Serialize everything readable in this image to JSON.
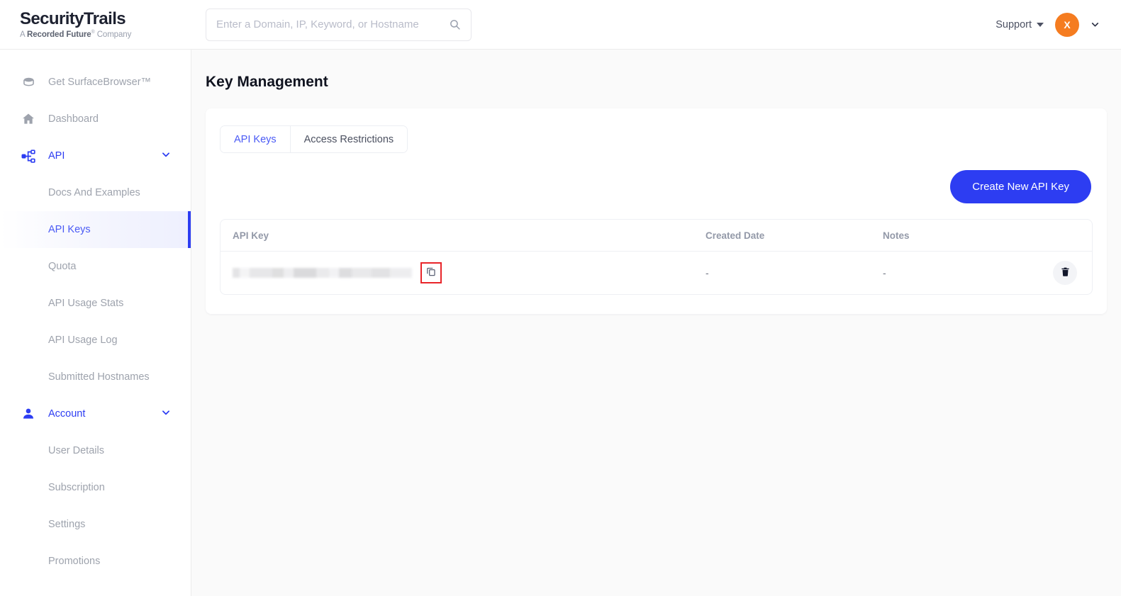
{
  "header": {
    "brand_main": "SecurityTrails",
    "brand_sub_pre": "A ",
    "brand_sub_bold": "Recorded Future",
    "brand_sub_post": " Company",
    "brand_sub_mark": "®",
    "search_placeholder": "Enter a Domain, IP, Keyword, or Hostname",
    "search_value": "",
    "search_icon": "search-icon",
    "support_label": "Support",
    "avatar_initial": "X",
    "avatar_color": "#f57c20",
    "user_chevron_icon": "chevron-down-icon"
  },
  "sidebar": {
    "items": [
      {
        "label": "Get SurfaceBrowser™",
        "icon": "database-icon",
        "type": "top",
        "state": "default"
      },
      {
        "label": "Dashboard",
        "icon": "home-icon",
        "type": "top",
        "state": "default"
      },
      {
        "label": "API",
        "icon": "sitemap-icon",
        "type": "top",
        "state": "expanded",
        "chevron": "chevron-down-icon"
      },
      {
        "label": "Docs And Examples",
        "type": "sub",
        "state": "default"
      },
      {
        "label": "API Keys",
        "type": "sub",
        "state": "active"
      },
      {
        "label": "Quota",
        "type": "sub",
        "state": "default"
      },
      {
        "label": "API Usage Stats",
        "type": "sub",
        "state": "default"
      },
      {
        "label": "API Usage Log",
        "type": "sub",
        "state": "default"
      },
      {
        "label": "Submitted Hostnames",
        "type": "sub",
        "state": "default"
      },
      {
        "label": "Account",
        "icon": "person-icon",
        "type": "top",
        "state": "expanded",
        "chevron": "chevron-down-icon"
      },
      {
        "label": "User Details",
        "type": "sub",
        "state": "default"
      },
      {
        "label": "Subscription",
        "type": "sub",
        "state": "default"
      },
      {
        "label": "Settings",
        "type": "sub",
        "state": "default"
      },
      {
        "label": "Promotions",
        "type": "sub",
        "state": "default"
      }
    ]
  },
  "main": {
    "page_title": "Key Management",
    "tabs": [
      {
        "label": "API Keys",
        "active": true
      },
      {
        "label": "Access Restrictions",
        "active": false
      }
    ],
    "create_button_label": "Create New API Key",
    "table": {
      "columns": [
        "API Key",
        "Created Date",
        "Notes"
      ],
      "rows": [
        {
          "api_key": "",
          "api_key_redacted": true,
          "created_date": "-",
          "notes": "-",
          "copy_icon": "copy-icon",
          "delete_icon": "trash-icon"
        }
      ]
    }
  },
  "annotation": {
    "highlight_color": "#e8252a",
    "highlight_target": "copy-api-key-button"
  },
  "theme": {
    "accent": "#2d3df2",
    "accent_link": "#4a5af5",
    "page_bg": "#fafafa",
    "muted_text": "#9ea3ad"
  }
}
